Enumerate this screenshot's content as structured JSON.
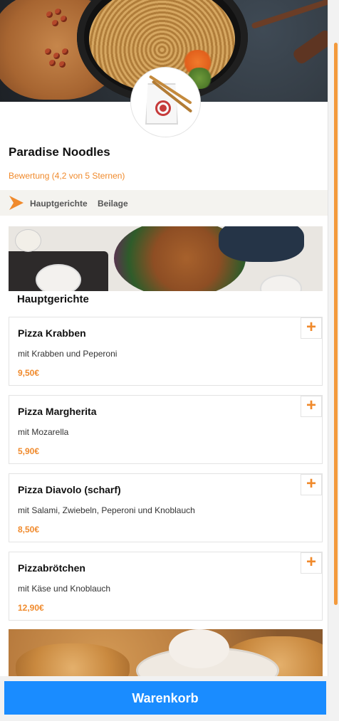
{
  "restaurant": {
    "name": "Paradise Noodles",
    "rating": "Bewertung (4,2 von 5 Sternen)"
  },
  "categories": [
    {
      "label": "Hauptgerichte"
    },
    {
      "label": "Beilage"
    }
  ],
  "section": {
    "title": "Hauptgerichte"
  },
  "items": [
    {
      "name": "Pizza Krabben",
      "description": "mit Krabben und Peperoni",
      "price": "9,50€",
      "add_label": "+"
    },
    {
      "name": "Pizza Margherita",
      "description": "mit Mozarella",
      "price": "5,90€",
      "add_label": "+"
    },
    {
      "name": "Pizza Diavolo (scharf)",
      "description": "mit Salami, Zwiebeln, Peperoni und Knoblauch",
      "price": "8,50€",
      "add_label": "+"
    },
    {
      "name": "Pizzabrötchen",
      "description": "mit Käse und Knoblauch",
      "price": "12,90€",
      "add_label": "+"
    }
  ],
  "cart": {
    "label": "Warenkorb"
  },
  "colors": {
    "accent": "#f08a2c",
    "cart_button": "#1a8cff",
    "category_bar": "#f4f3ef"
  },
  "icons": {
    "category_arrow": "arrow-right-icon",
    "add": "plus-icon"
  }
}
